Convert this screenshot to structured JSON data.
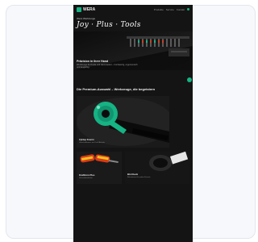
{
  "page": {
    "brand": "WERA",
    "nav_items": [
      "Produkte",
      "Service",
      "Kontakt"
    ]
  },
  "hero": {
    "kicker": "Wera Werkzeuge",
    "script_title": "Joy · Plus · Tools",
    "title": "Präzision in ihrer Hand",
    "description": "Werkzeuge für Profis und Heimwerker – hochwertig, ergonomisch und langlebig."
  },
  "section": {
    "title": "Die Premium-Auswahl – Werkzeuge, die begeistern"
  },
  "tiles": [
    {
      "caption": "Zyklop Knarre",
      "sub": "Umschaltknarre mit Dreh-Antrieb"
    },
    {
      "caption": "Kraftform Plus",
      "sub": "Schraubendreher"
    },
    {
      "caption": "Bit-Check",
      "sub": "Bitsortiment für jeden Einsatz"
    }
  ],
  "colors": {
    "accent": "#16b384",
    "background": "#141414",
    "tool_handle": "#16b384",
    "screwdriver_handle": "#d93a1a"
  },
  "icons": {
    "logo": "wera-logo-icon",
    "action": "chat-bubble-icon"
  }
}
